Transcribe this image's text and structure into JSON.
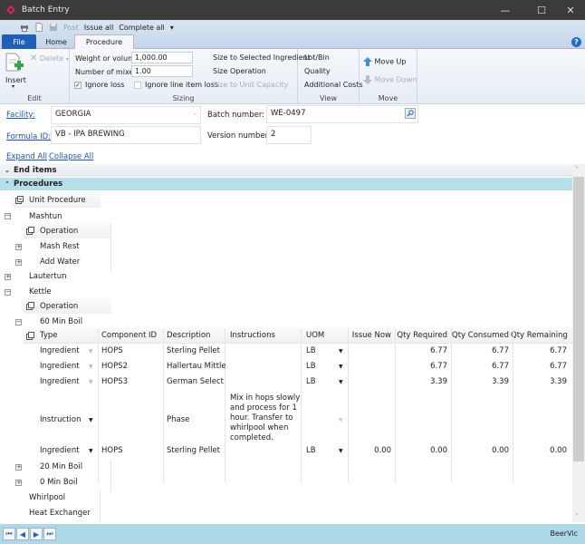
{
  "window": {
    "title": "Batch Entry",
    "brand_color": "#e0245e",
    "controls": {
      "minimize": "—",
      "maximize": "☐",
      "close": "✕"
    }
  },
  "quick_access": {
    "post": "Post",
    "issue_all": "Issue all",
    "complete_all": "Complete all",
    "more": "▾"
  },
  "tabs": {
    "file": "File",
    "home": "Home",
    "procedure": "Procedure"
  },
  "help": "?",
  "ribbon": {
    "edit": {
      "insert": "Insert",
      "insert_arrow": "▾",
      "delete": "Delete",
      "delete_arrow": "▾",
      "label": "Edit"
    },
    "sizing": {
      "weight_label": "Weight or volume:",
      "weight_value": "1,000.00",
      "mixes_label": "Number of mixes:",
      "mixes_value": "1.00",
      "ignore_loss": "Ignore loss",
      "ignore_loss_checked": "✓",
      "ignore_line_loss": "Ignore line item loss",
      "size_selected": "Size to Selected Ingredient",
      "size_operation": "Size Operation",
      "size_unit": "Size to Unit Capacity",
      "label": "Sizing"
    },
    "view": {
      "lot_bin": "Lot/Bin",
      "quality": "Quality",
      "additional_costs": "Additional Costs",
      "label": "View"
    },
    "move": {
      "up": "Move Up",
      "down": "Move Down",
      "label": "Move"
    }
  },
  "form": {
    "facility_label": "Facility:",
    "facility_value": "GEORGIA",
    "formula_label": "Formula ID:",
    "formula_value": "VB - IPA BREWING",
    "batch_label": "Batch number:",
    "batch_value": "WE-0497",
    "version_label": "Version number:",
    "version_value": "2",
    "expand_all": "Expand All",
    "collapse_all": "Collapse All"
  },
  "sections": {
    "end_items": "End items",
    "procedures": "Procedures",
    "collapsed": "⌄",
    "expanded": "⌃"
  },
  "tree": {
    "unit_header": "Unit Procedure",
    "operation_header": "Operation",
    "mashtun": "Mashtun",
    "mash_rest": "Mash Rest",
    "add_water": "Add Water",
    "lautertun": "Lautertun",
    "kettle": "Kettle",
    "boil60": "60 Min Boil",
    "boil20": "20 Min Boil",
    "boil0": "0 Min Boil",
    "whirlpool": "Whirlpool",
    "heat_exchanger": "Heat Exchanger",
    "plus": "+",
    "minus": "−"
  },
  "table": {
    "columns": [
      "Type",
      "Component ID",
      "Description",
      "Instructions",
      "UOM",
      "Issue Now",
      "Qty Required",
      "Qty Consumed",
      "Qty Remaining"
    ],
    "rows": [
      {
        "type": "Ingredient",
        "component": "HOPS",
        "description": "Sterling Pellet",
        "instructions": "",
        "uom": "LB",
        "issue_now": "",
        "qty_required": "6.77",
        "qty_consumed": "6.77",
        "qty_remaining": "6.77"
      },
      {
        "type": "Ingredient",
        "component": "HOPS2",
        "description": "Hallertau Mittlefr",
        "instructions": "",
        "uom": "LB",
        "issue_now": "",
        "qty_required": "6.77",
        "qty_consumed": "6.77",
        "qty_remaining": "6.77"
      },
      {
        "type": "Ingredient",
        "component": "HOPS3",
        "description": "German Select",
        "instructions": "",
        "uom": "LB",
        "issue_now": "",
        "qty_required": "3.39",
        "qty_consumed": "3.39",
        "qty_remaining": "3.39"
      },
      {
        "type": "Instruction",
        "component": "",
        "description": "Phase",
        "instructions": "Mix in hops slowly and process for 1 hour.  Transfer to whirlpool when completed.",
        "uom": "",
        "issue_now": "",
        "qty_required": "",
        "qty_consumed": "",
        "qty_remaining": ""
      },
      {
        "type": "Ingredient",
        "component": "HOPS",
        "description": "Sterling Pellet",
        "instructions": "",
        "uom": "LB",
        "issue_now": "0.00",
        "qty_required": "0.00",
        "qty_consumed": "0.00",
        "qty_remaining": "0.00"
      }
    ],
    "dropdown": "▼"
  },
  "status": {
    "nav": {
      "first": "⏮",
      "prev": "◀",
      "next": "▶",
      "last": "⏭"
    },
    "user": "BeerVic"
  }
}
